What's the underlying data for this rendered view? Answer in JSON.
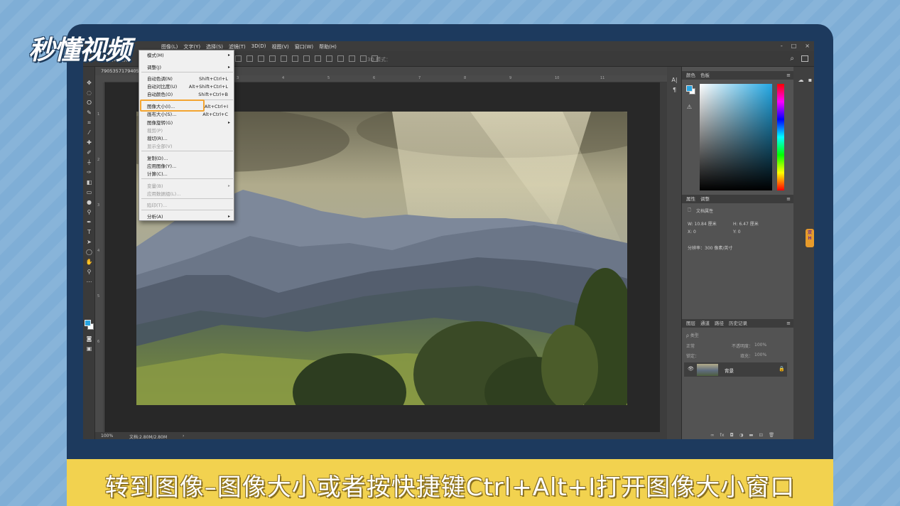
{
  "watermark": {
    "logo_text": "秒懂视频"
  },
  "ps": {
    "menubar": [
      "图像(L)",
      "文字(Y)",
      "选择(S)",
      "滤镜(T)",
      "3D(D)",
      "视图(V)",
      "窗口(W)",
      "帮助(H)"
    ],
    "window_controls": [
      "-",
      "□",
      "×"
    ],
    "options": {
      "auto_select_label": "自动选择：",
      "mode_3d_label": "3D 模式："
    },
    "doc_tab": "79053571794059",
    "ruler_top": [
      "1",
      "2",
      "3",
      "4",
      "5",
      "6",
      "7",
      "8",
      "9",
      "10",
      "11"
    ],
    "ruler_left": [
      "1",
      "2",
      "3",
      "4",
      "5",
      "6"
    ],
    "status": {
      "zoom": "100%",
      "doc": "文档:2.80M/2.80M",
      "arrow": "›"
    },
    "image_menu": {
      "top_item": "模式(M)",
      "items": [
        {
          "label": "调整(J)",
          "shortcut": "",
          "submenu": true,
          "disabled": false
        },
        {
          "label": "自动色调(N)",
          "shortcut": "Shift+Ctrl+L",
          "submenu": false,
          "disabled": false
        },
        {
          "label": "自动对比度(U)",
          "shortcut": "Alt+Shift+Ctrl+L",
          "submenu": false,
          "disabled": false
        },
        {
          "label": "自动颜色(O)",
          "shortcut": "Shift+Ctrl+B",
          "submenu": false,
          "disabled": false
        },
        {
          "label": "图像大小(I)...",
          "shortcut": "Alt+Ctrl+I",
          "submenu": false,
          "disabled": false
        },
        {
          "label": "画布大小(S)...",
          "shortcut": "Alt+Ctrl+C",
          "submenu": false,
          "disabled": false
        },
        {
          "label": "图像旋转(G)",
          "shortcut": "",
          "submenu": true,
          "disabled": false
        },
        {
          "label": "裁剪(P)",
          "shortcut": "",
          "submenu": false,
          "disabled": true
        },
        {
          "label": "裁切(R)...",
          "shortcut": "",
          "submenu": false,
          "disabled": false
        },
        {
          "label": "显示全部(V)",
          "shortcut": "",
          "submenu": false,
          "disabled": true
        },
        {
          "label": "复制(D)...",
          "shortcut": "",
          "submenu": false,
          "disabled": false
        },
        {
          "label": "应用图像(Y)...",
          "shortcut": "",
          "submenu": false,
          "disabled": false
        },
        {
          "label": "计算(C)...",
          "shortcut": "",
          "submenu": false,
          "disabled": false
        },
        {
          "label": "变量(B)",
          "shortcut": "",
          "submenu": true,
          "disabled": true
        },
        {
          "label": "应用数据组(L)...",
          "shortcut": "",
          "submenu": false,
          "disabled": true
        },
        {
          "label": "陷印(T)...",
          "shortcut": "",
          "submenu": false,
          "disabled": true
        },
        {
          "label": "分析(A)",
          "shortcut": "",
          "submenu": true,
          "disabled": false
        }
      ]
    },
    "color_panel": {
      "tabs": [
        "颜色",
        "色板"
      ]
    },
    "properties_panel": {
      "tabs": [
        "属性",
        "调整"
      ],
      "title": "文档属性",
      "w": "W: 10.84 厘米",
      "h": "H: 6.47 厘米",
      "x": "X: 0",
      "y": "Y: 0",
      "resolution": "分辨率：300 像素/英寸"
    },
    "layers_panel": {
      "tabs": [
        "图层",
        "通道",
        "路径",
        "历史记录"
      ],
      "filter_label": "ρ 类型",
      "blend_mode": "正常",
      "opacity_label": "不透明度：",
      "opacity_value": "100%",
      "lock_label": "锁定：",
      "fill_label": "填充：",
      "fill_value": "100%",
      "layer_name": "背景",
      "bottom_icons": [
        "∞",
        "fx",
        "◘",
        "◑",
        "▬",
        "⊡",
        "🗑"
      ]
    }
  },
  "subtitle": "转到图像–图像大小或者按快捷键Ctrl+Alt+I打开图像大小窗口",
  "colors": {
    "frame": "#1d3a5e",
    "subtitle_bar": "#f2d24f",
    "highlight": "#f3a531",
    "foreground_swatch": "#29a3df"
  }
}
